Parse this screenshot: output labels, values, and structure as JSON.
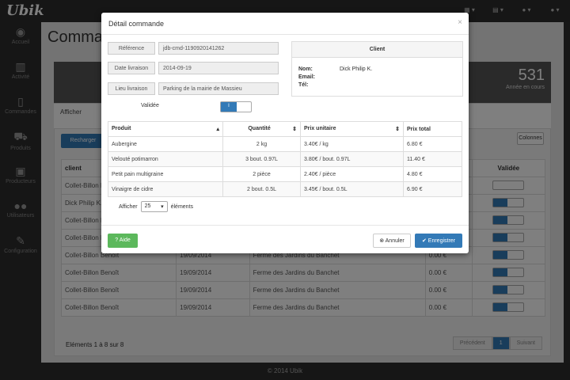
{
  "app": {
    "logo": "Ubik"
  },
  "topbar": {
    "icons": [
      "▾",
      "▾",
      "▾",
      "▾"
    ]
  },
  "sidebar": {
    "items": [
      {
        "label": "Accueil",
        "icon": "dashboard-icon"
      },
      {
        "label": "Activité",
        "icon": "chart-icon"
      },
      {
        "label": "Commandes",
        "icon": "file-icon"
      },
      {
        "label": "Produits",
        "icon": "cart-icon"
      },
      {
        "label": "Producteurs",
        "icon": "truck-icon"
      },
      {
        "label": "Utilisateurs",
        "icon": "users-icon"
      },
      {
        "label": "Configuration",
        "icon": "wrench-icon"
      }
    ]
  },
  "main": {
    "title": "Comman",
    "stat": {
      "number": "531",
      "caption": "Année en cours"
    },
    "panel_footer": "Afficher",
    "reload_label": "Recharger",
    "columns_label": "Colonnes",
    "table": {
      "headers": [
        "client",
        "",
        "",
        "",
        "Validée"
      ],
      "rows": [
        [
          "Collet-Billon Be",
          "",
          "",
          ""
        ],
        [
          "Dick Philip K.",
          "",
          "",
          ""
        ],
        [
          "Collet-Billon Be",
          "",
          "",
          ""
        ],
        [
          "Collet-Billon Be",
          "",
          "",
          ""
        ],
        [
          "Collet-Billon Benoît",
          "19/09/2014",
          "Ferme des Jardins du Banchet",
          "0.00 €"
        ],
        [
          "Collet-Billon Benoît",
          "19/09/2014",
          "Ferme des Jardins du Banchet",
          "0.00 €"
        ],
        [
          "Collet-Billon Benoît",
          "19/09/2014",
          "Ferme des Jardins du Banchet",
          "0.00 €"
        ],
        [
          "Collet-Billon Benoît",
          "19/09/2014",
          "Ferme des Jardins du Banchet",
          "0.00 €"
        ]
      ]
    },
    "pager_info": "Eléments 1 à 8 sur 8",
    "pager": {
      "prev": "Précédent",
      "page": "1",
      "next": "Suivant"
    }
  },
  "footer": "© 2014 Ubik",
  "modal": {
    "title": "Détail commande",
    "close": "×",
    "reference_label": "Référence",
    "reference_value": "jdb-cmd-1190920141262",
    "date_label": "Date livraison",
    "date_value": "2014-09-19",
    "lieu_label": "Lieu livraison",
    "lieu_value": "Parking de la mairie de Massieu",
    "valid_label": "Validée",
    "valid_toggle": "I",
    "client": {
      "heading": "Client",
      "nom_label": "Nom:",
      "nom_value": "Dick Philip K.",
      "email_label": "Email:",
      "tel_label": "Tél:"
    },
    "products": {
      "headers": [
        "Produit",
        "Quantité",
        "Prix unitaire",
        "Prix total"
      ],
      "rows": [
        [
          "Aubergine",
          "2 kg",
          "3.40€ / kg",
          "6.80 €"
        ],
        [
          "Velouté potimarron",
          "3 bout. 0.97L",
          "3.80€ / bout. 0.97L",
          "11.40 €"
        ],
        [
          "Petit pain multigraine",
          "2 pièce",
          "2.40€ / pièce",
          "4.80 €"
        ],
        [
          "Vinaigre de cidre",
          "2 bout. 0.5L",
          "3.45€ / bout. 0.5L",
          "6.90 €"
        ]
      ]
    },
    "show_label": "Afficher",
    "show_value": "25",
    "show_suffix": "éléments",
    "help_label": "Aide",
    "cancel_label": "Annuler",
    "save_label": "Enregistrer"
  }
}
